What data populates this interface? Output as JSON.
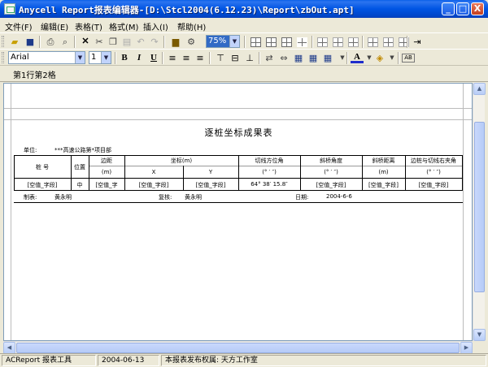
{
  "window": {
    "title": "Anycell Report报表编辑器-[D:\\Stcl2004(6.12.23)\\Report\\zbOut.apt]",
    "minimize": "_",
    "maximize": "□",
    "close": "X"
  },
  "menu": [
    {
      "label": "文件(F)"
    },
    {
      "label": "编辑(E)"
    },
    {
      "label": "表格(T)"
    },
    {
      "label": "格式(M)"
    },
    {
      "label": "插入(I)"
    },
    {
      "label": "帮助(H)"
    }
  ],
  "toolbar1": {
    "zoom": "75%"
  },
  "toolbar2": {
    "font": "Arial",
    "size": "1",
    "bold": "B",
    "italic": "I",
    "underline": "U",
    "font_color": "A",
    "small_text": "AB"
  },
  "tabstrip": {
    "cell_ref": "第1行第2格"
  },
  "report": {
    "title": "逐桩坐标成果表",
    "unit_label": "单位:",
    "unit_value": "***高速公路第*项目部",
    "headers": {
      "pile": "桩  号",
      "pos": "位置",
      "offset": "边距",
      "offset_unit": "(m)",
      "coord": "坐标(m)",
      "x": "X",
      "y": "Y",
      "tangent": "切线方位角",
      "tangent_unit": "(° ′ ″)",
      "skew": "斜桥角度",
      "skew_unit": "(° ′ ″)",
      "dist": "斜桥距离",
      "dist_unit": "(m)",
      "edge": "边桩与切线右夹角",
      "edge_unit": "(° ′ ″)"
    },
    "row": {
      "pile": "[空值_字段]",
      "pos": "中",
      "offset": "[空值_字",
      "x": "[空值_字段]",
      "y": "[空值_字段]",
      "tangent": "64° 38′ 15.8″",
      "skew": "[空值_字段]",
      "dist": "[空值_字段]",
      "edge": "[空值_字段]"
    },
    "footer": {
      "maker_label": "制表:",
      "maker": "黄永明",
      "checker_label": "复核:",
      "checker": "黄永明",
      "date_label": "日期:",
      "date": "2004-6-6"
    }
  },
  "statusbar": {
    "app": "ACReport 报表工具",
    "date": "2004-06-13",
    "copyright": "本报表发布权属: 天方工作室"
  }
}
